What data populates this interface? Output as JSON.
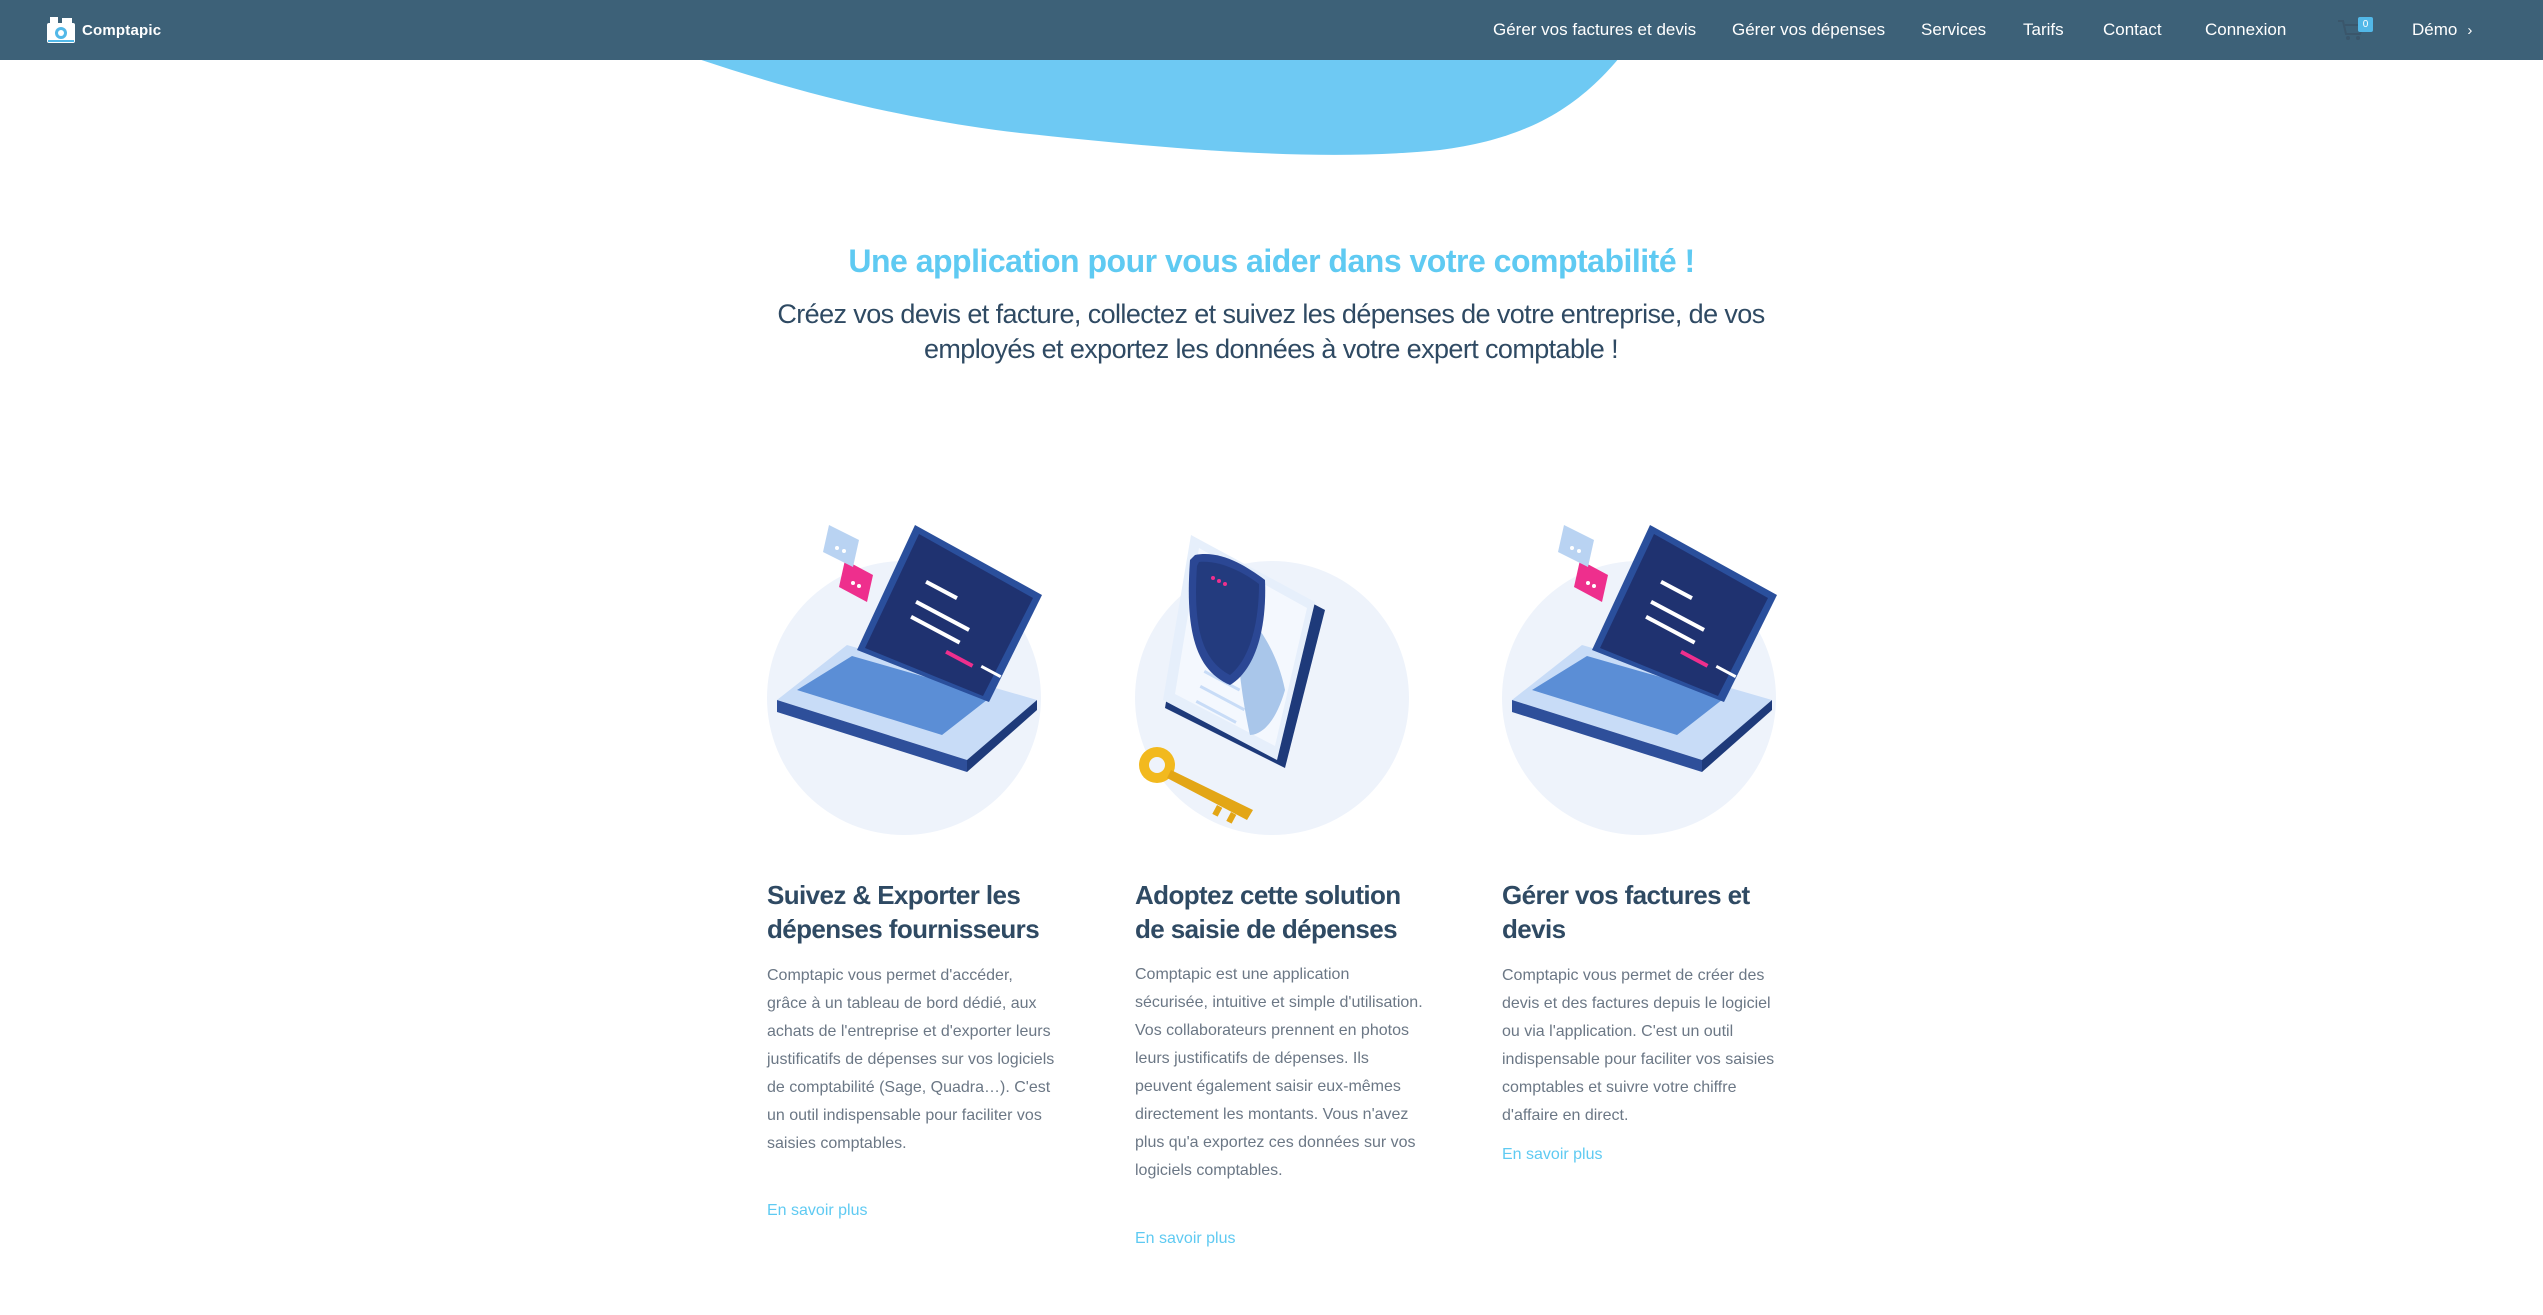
{
  "brand": {
    "name": "Comptapic",
    "logo_icon": "camera-icon"
  },
  "nav": {
    "items": [
      "Gérer vos factures et devis",
      "Gérer vos dépenses",
      "Services",
      "Tarifs",
      "Contact",
      "Connexion"
    ],
    "cart_count": "0",
    "cart_icon": "cart-icon",
    "demo_label": "Démo",
    "demo_chevron": "chevron-right-icon"
  },
  "colors": {
    "header_bg": "#3d6178",
    "accent": "#5fcaf2",
    "wave": "#6ec9f3",
    "heading": "#2f4a63",
    "body_text": "#6b7785"
  },
  "intro": {
    "headline": "Une application pour vous aider dans votre comptabilité !",
    "subheadline": "Créez vos devis et facture, collectez et suivez les dépenses de votre entreprise, de vos employés et exportez les données à votre expert comptable !"
  },
  "features": [
    {
      "illustration": "laptop-illustration",
      "title": "Suivez & Exporter les dépenses fournisseurs",
      "text": "Comptapic vous permet d'accéder, grâce à un tableau de bord dédié, aux achats de l'entreprise et d'exporter leurs justificatifs de dépenses sur vos logiciels de comptabilité (Sage, Quadra…). C'est un outil indispensable pour faciliter vos saisies comptables.",
      "link": "En savoir plus"
    },
    {
      "illustration": "phone-shield-key-illustration",
      "title": "Adoptez cette solution de saisie de dépenses",
      "text": "Comptapic est une application sécurisée, intuitive et simple d'utilisation. Vos collaborateurs prennent en photos leurs justificatifs de dépenses. Ils peuvent également saisir eux-mêmes directement les montants. Vous n'avez plus qu'a exportez ces données sur vos logiciels comptables.",
      "link": "En savoir plus"
    },
    {
      "illustration": "laptop-illustration",
      "title": "Gérer vos factures et devis",
      "text": "Comptapic vous permet de créer des devis et des factures depuis le logiciel ou via l'application. C'est un outil indispensable pour faciliter vos saisies comptables et suivre votre chiffre d'affaire en direct.",
      "link": "En savoir plus"
    }
  ]
}
